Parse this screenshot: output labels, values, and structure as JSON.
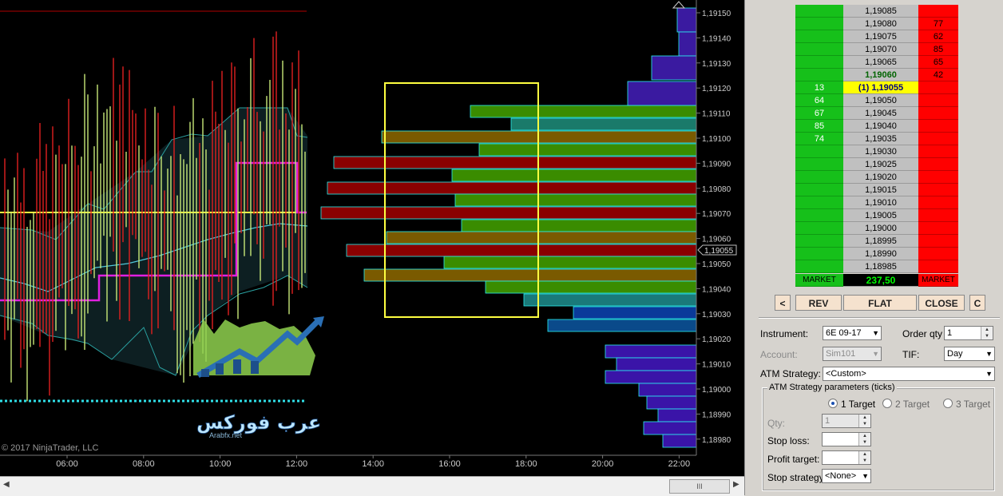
{
  "chart": {
    "copyright": "© 2017 NinjaTrader, LLC",
    "time_labels": [
      "06:00",
      "08:00",
      "10:00",
      "12:00",
      "14:00",
      "16:00",
      "18:00",
      "20:00",
      "22:00"
    ],
    "price_labels": [
      "1,19150",
      "1,19140",
      "1,19130",
      "1,19120",
      "1,19110",
      "1,19100",
      "1,19090",
      "1,19080",
      "1,19070",
      "1,19060",
      "1,19050",
      "1,19040",
      "1,19030",
      "1,19020",
      "1,19010",
      "1,19000",
      "1,18990",
      "1,18980"
    ],
    "current_price": "1,19055",
    "logo_text": "عرب فوركس",
    "logo_subtext": "Arabfx.net",
    "scroll_thumb": "III"
  },
  "ladder": {
    "rows": [
      {
        "bid": "",
        "price": "1,19085",
        "ask": ""
      },
      {
        "bid": "",
        "price": "1,19080",
        "ask": "77"
      },
      {
        "bid": "",
        "price": "1,19075",
        "ask": "62"
      },
      {
        "bid": "",
        "price": "1,19070",
        "ask": "85"
      },
      {
        "bid": "",
        "price": "1,19065",
        "ask": "65"
      },
      {
        "bid": "",
        "price": "1,19060",
        "ask": "42",
        "kind": "last"
      },
      {
        "bid": "13",
        "price": "(1) 1,19055",
        "ask": "",
        "kind": "cur"
      },
      {
        "bid": "64",
        "price": "1,19050",
        "ask": ""
      },
      {
        "bid": "67",
        "price": "1,19045",
        "ask": ""
      },
      {
        "bid": "85",
        "price": "1,19040",
        "ask": ""
      },
      {
        "bid": "74",
        "price": "1,19035",
        "ask": ""
      },
      {
        "bid": "",
        "price": "1,19030",
        "ask": ""
      },
      {
        "bid": "",
        "price": "1,19025",
        "ask": ""
      },
      {
        "bid": "",
        "price": "1,19020",
        "ask": ""
      },
      {
        "bid": "",
        "price": "1,19015",
        "ask": ""
      },
      {
        "bid": "",
        "price": "1,19010",
        "ask": ""
      },
      {
        "bid": "",
        "price": "1,19005",
        "ask": ""
      },
      {
        "bid": "",
        "price": "1,19000",
        "ask": ""
      },
      {
        "bid": "",
        "price": "1,18995",
        "ask": ""
      },
      {
        "bid": "",
        "price": "1,18990",
        "ask": ""
      },
      {
        "bid": "",
        "price": "1,18985",
        "ask": ""
      }
    ],
    "market_bid_label": "MARKET",
    "market_value": "237,50",
    "market_ask_label": "MARKET"
  },
  "buttons": {
    "left": "<",
    "rev": "REV",
    "flat": "FLAT",
    "close": "CLOSE",
    "c": "C"
  },
  "form": {
    "instrument_label": "Instrument:",
    "instrument_value": "6E 09-17",
    "order_qty_label": "Order qty",
    "order_qty_value": "1",
    "account_label": "Account:",
    "account_value": "Sim101",
    "tif_label": "TIF:",
    "tif_value": "Day",
    "atm_label": "ATM Strategy:",
    "atm_value": "<Custom>",
    "params_title": "ATM Strategy parameters (ticks)",
    "target1": "1 Target",
    "target2": "2 Target",
    "target3": "3 Target",
    "qty_label": "Qty:",
    "qty_value": "1",
    "stop_loss_label": "Stop loss:",
    "profit_target_label": "Profit target:",
    "stop_strategy_label": "Stop strategy:",
    "stop_strategy_value": "<None>"
  }
}
